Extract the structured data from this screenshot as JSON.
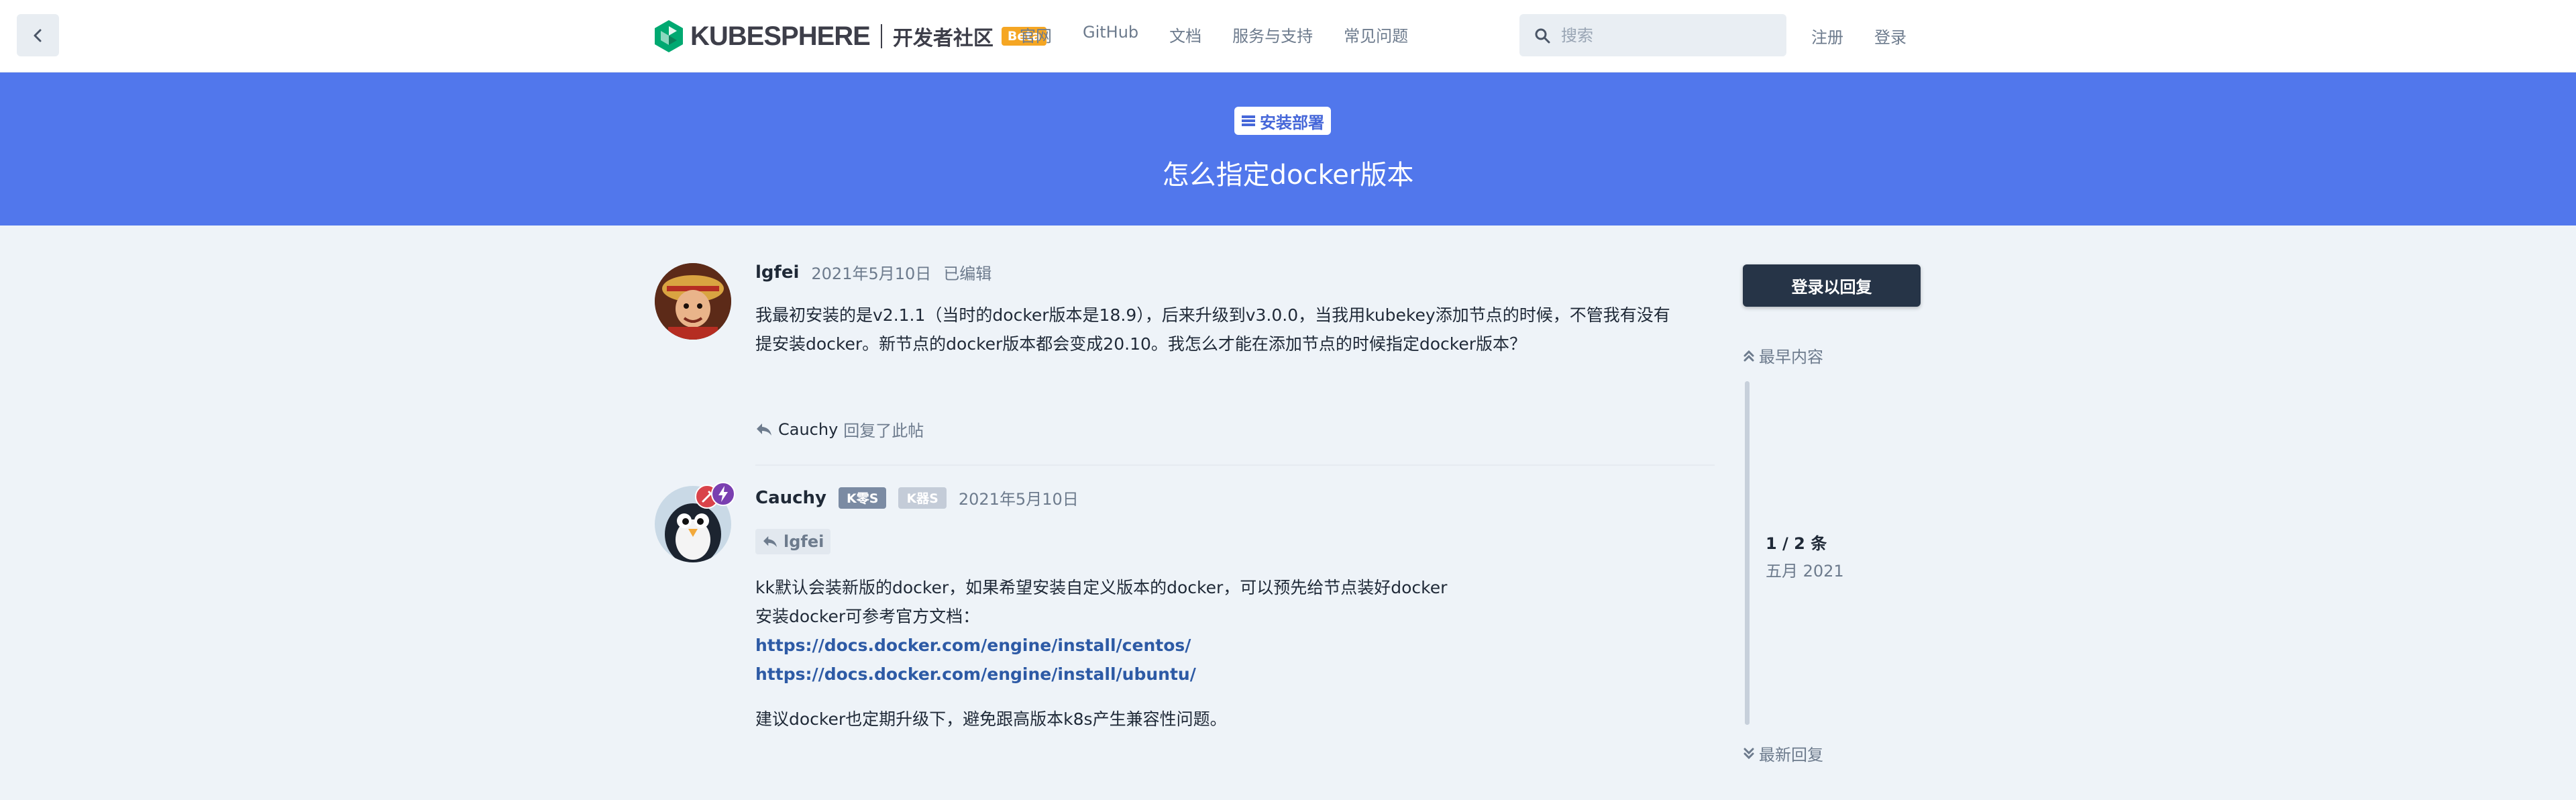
{
  "header": {
    "logo_text": "KUBESPHERE",
    "community": "开发者社区",
    "beta": "Beta",
    "nav": [
      "官网",
      "GitHub",
      "文档",
      "服务与支持",
      "常见问题"
    ],
    "search_placeholder": "搜索",
    "signup": "注册",
    "login": "登录"
  },
  "hero": {
    "tag": "安装部署",
    "title": "怎么指定docker版本",
    "color": "#5177ec"
  },
  "posts": [
    {
      "username": "lgfei",
      "date": "2021年5月10日",
      "edited": "已编辑",
      "lines": [
        "我最初安装的是v2.1.1（当时的docker版本是18.9），后来升级到v3.0.0，当我用kubekey添加节点的时候，不管我有没有",
        "提安装docker。新节点的docker版本都会变成20.10。我怎么才能在添加节点的时候指定docker版本？"
      ],
      "reply_by": "Cauchy",
      "reply_text": "回复了此帖"
    },
    {
      "username": "Cauchy",
      "badges": [
        "K零S",
        "K器S"
      ],
      "date": "2021年5月10日",
      "mention": "lgfei",
      "lines": [
        "kk默认会装新版的docker，如果希望安装自定义版本的docker，可以预先给节点装好docker",
        "安装docker可参考官方文档："
      ],
      "links": [
        "https://docs.docker.com/engine/install/centos/",
        "https://docs.docker.com/engine/install/ubuntu/"
      ],
      "closing": "建议docker也定期升级下，避免跟高版本k8s产生兼容性问题。"
    }
  ],
  "sidebar": {
    "reply_button": "登录以回复",
    "earliest": "最早内容",
    "position": "1 / 2 条",
    "month": "五月 2021",
    "latest": "最新回复"
  }
}
